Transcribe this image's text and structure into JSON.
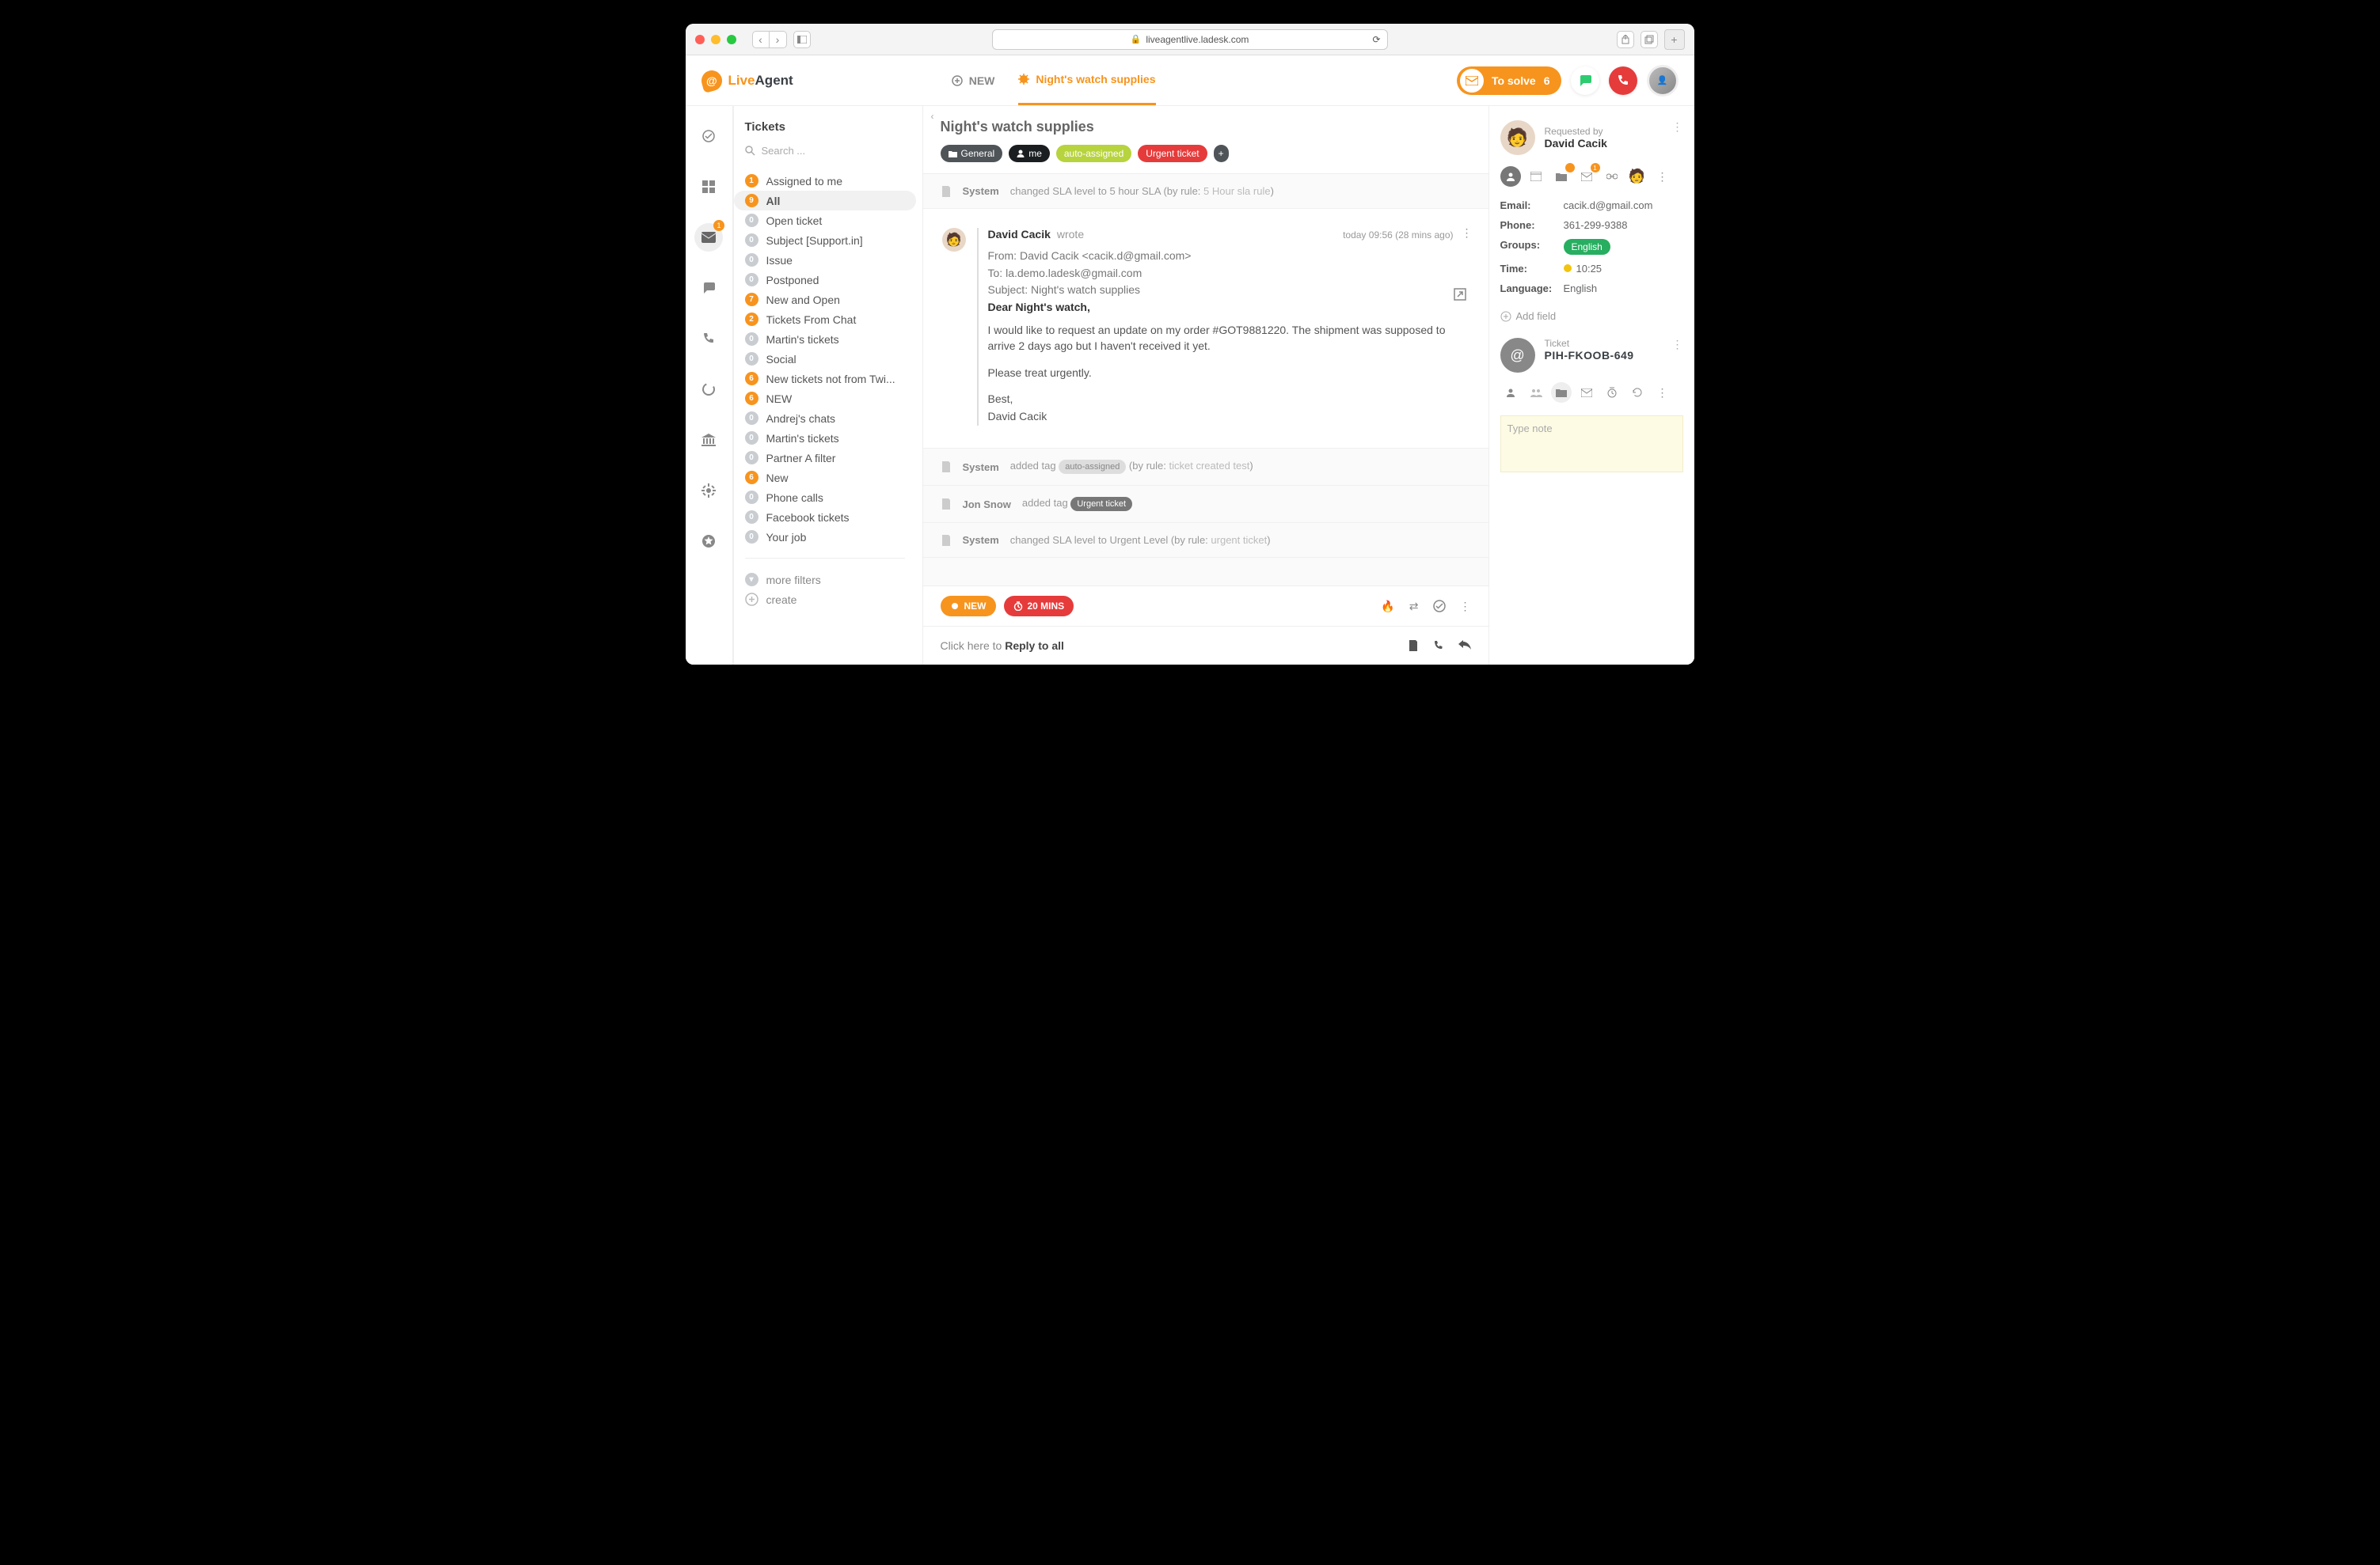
{
  "browser": {
    "url": "liveagentlive.ladesk.com"
  },
  "brand": {
    "live": "Live",
    "agent": "Agent"
  },
  "header": {
    "new_label": "NEW",
    "active_tab": "Night's watch supplies",
    "solve_label": "To solve",
    "solve_count": "6"
  },
  "rail": {
    "mail_badge": "1"
  },
  "sidebar": {
    "title": "Tickets",
    "search_placeholder": "Search ...",
    "items": [
      {
        "count": "1",
        "color": "orange",
        "label": "Assigned to me"
      },
      {
        "count": "9",
        "color": "orange",
        "label": "All",
        "active": true
      },
      {
        "count": "0",
        "color": "grey",
        "label": "Open ticket"
      },
      {
        "count": "0",
        "color": "grey",
        "label": "Subject [Support.in]"
      },
      {
        "count": "0",
        "color": "grey",
        "label": "Issue"
      },
      {
        "count": "0",
        "color": "grey",
        "label": "Postponed"
      },
      {
        "count": "7",
        "color": "orange",
        "label": "New and Open"
      },
      {
        "count": "2",
        "color": "orange",
        "label": "Tickets From Chat"
      },
      {
        "count": "0",
        "color": "grey",
        "label": "Martin's tickets"
      },
      {
        "count": "0",
        "color": "grey",
        "label": "Social"
      },
      {
        "count": "6",
        "color": "orange",
        "label": "New tickets not from Twi..."
      },
      {
        "count": "6",
        "color": "orange",
        "label": "NEW"
      },
      {
        "count": "0",
        "color": "grey",
        "label": "Andrej's chats"
      },
      {
        "count": "0",
        "color": "grey",
        "label": "Martin's tickets"
      },
      {
        "count": "0",
        "color": "grey",
        "label": "Partner A filter"
      },
      {
        "count": "6",
        "color": "orange",
        "label": "New"
      },
      {
        "count": "0",
        "color": "grey",
        "label": "Phone calls"
      },
      {
        "count": "0",
        "color": "grey",
        "label": "Facebook tickets"
      },
      {
        "count": "0",
        "color": "grey",
        "label": "Your job"
      }
    ],
    "more": "more filters",
    "create": "create"
  },
  "ticket": {
    "title": "Night's watch supplies",
    "chips": {
      "folder": "General",
      "assignee": "me",
      "auto": "auto-assigned",
      "urgent": "Urgent ticket"
    }
  },
  "events": [
    {
      "type": "system",
      "who": "System",
      "text": "changed SLA level to 5 hour SLA (by rule: ",
      "link": "5 Hour sla rule",
      "after": ")"
    }
  ],
  "message": {
    "author": "David Cacik",
    "wrote": "wrote",
    "time": "today 09:56 (28 mins ago)",
    "from_label": "From: ",
    "from": "David Cacik <cacik.d@gmail.com>",
    "to_label": "To: ",
    "to": "la.demo.ladesk@gmail.com",
    "subject_label": "Subject: ",
    "subject": "Night's watch supplies",
    "greeting": "Dear Night's watch,",
    "body1": "I would like to request an update on my order #GOT9881220. The shipment was supposed to arrive 2 days ago but I haven't received it yet.",
    "body2": "Please treat urgently.",
    "signoff": "Best,",
    "signature": "David Cacik"
  },
  "events2": [
    {
      "who": "System",
      "text": "added tag ",
      "tag": "auto-assigned",
      "afterTag": " (by rule: ",
      "link": "ticket created test",
      "after": ")"
    },
    {
      "who": "Jon Snow",
      "text": "added tag ",
      "tag": "Urgent ticket",
      "redTag": true
    },
    {
      "who": "System",
      "text": "changed SLA level to Urgent Level (by rule: ",
      "link": "urgent ticket",
      "after": ")"
    }
  ],
  "status": {
    "new": "NEW",
    "timer": "20 MINS"
  },
  "reply": {
    "prefix": "Click here to ",
    "bold": "Reply to all"
  },
  "requester": {
    "label": "Requested by",
    "name": "David Cacik",
    "fields": {
      "email_k": "Email:",
      "email_v": "cacik.d@gmail.com",
      "phone_k": "Phone:",
      "phone_v": "361-299-9388",
      "groups_k": "Groups:",
      "groups_v": "English",
      "time_k": "Time:",
      "time_v": "10:25",
      "lang_k": "Language:",
      "lang_v": "English"
    },
    "add_field": "Add field",
    "icon_badge_1": "1"
  },
  "ticket_meta": {
    "label": "Ticket",
    "id": "PIH-FKOOB-649",
    "note_placeholder": "Type note"
  }
}
